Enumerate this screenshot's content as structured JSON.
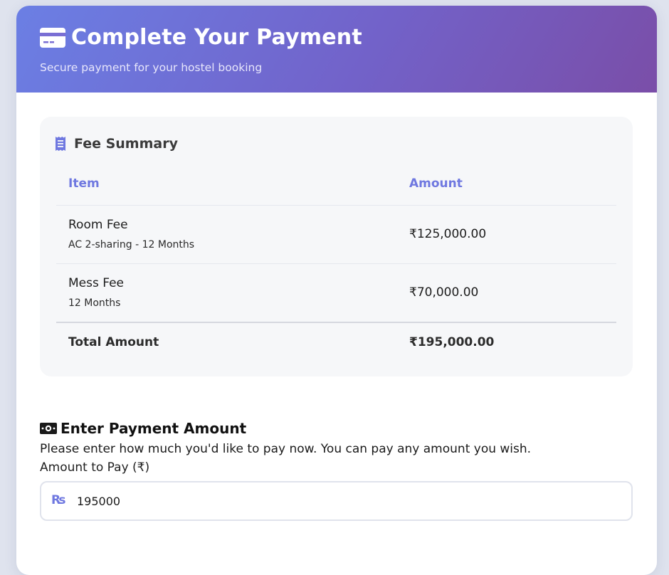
{
  "header": {
    "title": "Complete Your Payment",
    "subtitle": "Secure payment for your hostel booking",
    "icon": "credit-card-icon"
  },
  "fee_summary": {
    "title": "Fee Summary",
    "icon": "receipt-icon",
    "columns": [
      "Item",
      "Amount"
    ],
    "rows": [
      {
        "item": "Room Fee",
        "detail": "AC 2-sharing - 12 Months",
        "amount": "₹125,000.00"
      },
      {
        "item": "Mess Fee",
        "detail": "12 Months",
        "amount": "₹70,000.00"
      }
    ],
    "total": {
      "label": "Total Amount",
      "amount": "₹195,000.00"
    }
  },
  "payment": {
    "title": "Enter Payment Amount",
    "icon": "money-icon",
    "description": "Please enter how much you'd like to pay now. You can pay any amount you wish.",
    "amount_label": "Amount to Pay (₹)",
    "currency_icon_text": "₨",
    "amount_value": "195000"
  },
  "colors": {
    "accent": "#6f78e0",
    "header_gradient_start": "#6b7fe4",
    "header_gradient_end": "#7a4ea8"
  }
}
